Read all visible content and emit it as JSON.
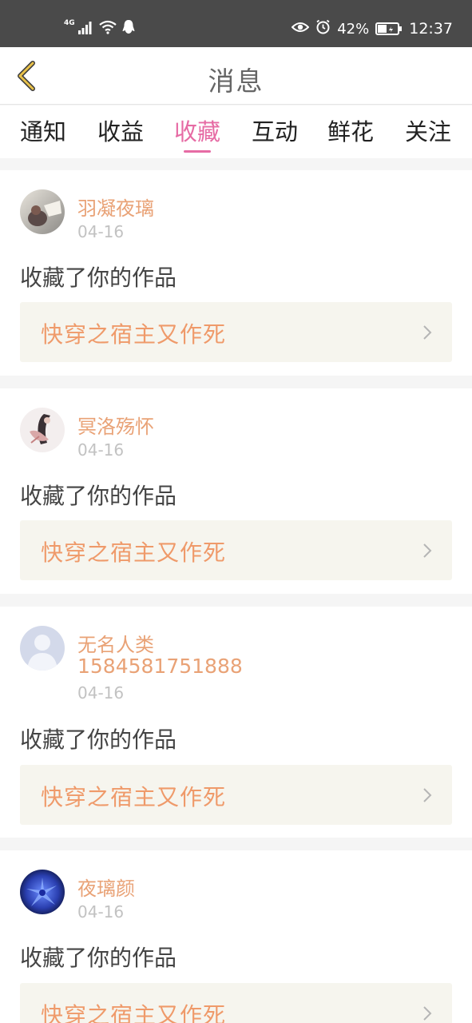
{
  "status_bar": {
    "network": "4G",
    "battery": "42%",
    "time": "12:37"
  },
  "header": {
    "title": "消息"
  },
  "tabs": [
    {
      "label": "通知",
      "active": false
    },
    {
      "label": "收益",
      "active": false
    },
    {
      "label": "收藏",
      "active": true
    },
    {
      "label": "互动",
      "active": false
    },
    {
      "label": "鲜花",
      "active": false
    },
    {
      "label": "关注",
      "active": false
    }
  ],
  "notifications": [
    {
      "user": "羽凝夜璃",
      "date": "04-16",
      "action": "收藏了你的作品",
      "work": "快穿之宿主又作死"
    },
    {
      "user": "冥洛殇怀",
      "date": "04-16",
      "action": "收藏了你的作品",
      "work": "快穿之宿主又作死"
    },
    {
      "user": "无名人类",
      "user_id": "1584581751888",
      "date": "04-16",
      "action": "收藏了你的作品",
      "work": "快穿之宿主又作死"
    },
    {
      "user": "夜璃颜",
      "date": "04-16",
      "action": "收藏了你的作品",
      "work": "快穿之宿主又作死"
    }
  ],
  "colors": {
    "accent": "#e66ba4",
    "name": "#e9a276",
    "work_title": "#ef9a6a",
    "work_bg": "#f6f5ee",
    "status_bar": "#4a4a4a",
    "back_arrow": "#e8c14a"
  }
}
